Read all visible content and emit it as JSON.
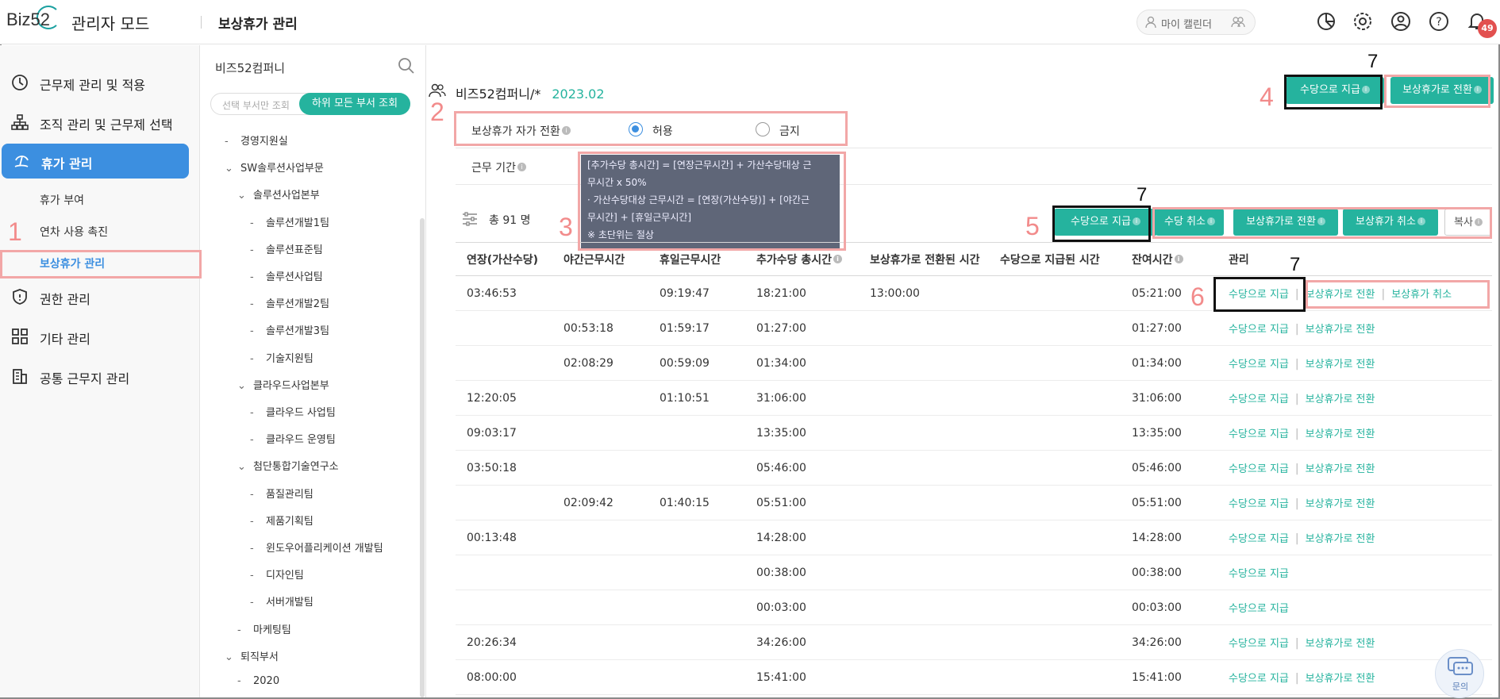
{
  "app": {
    "logo": "Biz52",
    "mode": "관리자 모드",
    "page": "보상휴가 관리"
  },
  "header": {
    "my_calendar": "마이 캘린더",
    "notif_count": "49"
  },
  "nav": {
    "items": [
      {
        "label": "근무제 관리 및 적용",
        "icon": "clock-icon"
      },
      {
        "label": "조직 관리 및 근무제 선택",
        "icon": "org-chart-icon"
      },
      {
        "label": "휴가 관리",
        "icon": "vacation-icon",
        "active": true
      },
      {
        "label": "권한 관리",
        "icon": "shield-icon"
      },
      {
        "label": "기타 관리",
        "icon": "grid-icon"
      },
      {
        "label": "공통 근무지 관리",
        "icon": "building-icon"
      }
    ],
    "sub": [
      "휴가 부여",
      "연차 사용 촉진",
      "보상휴가 관리"
    ]
  },
  "tree": {
    "company": "비즈52컴퍼니",
    "toggle_off": "선택 부서만 조회",
    "toggle_on": "하위 모든 부서 조회",
    "nodes": [
      {
        "label": "경영지원실",
        "mark": "-"
      },
      {
        "label": "SW솔루션사업부문",
        "mark": "v"
      },
      {
        "label": "솔루션사업본부",
        "mark": "v"
      },
      {
        "label": "솔루션개발1팀",
        "mark": "-"
      },
      {
        "label": "솔루션표준팀",
        "mark": "-"
      },
      {
        "label": "솔루션사업팀",
        "mark": "-"
      },
      {
        "label": "솔루션개발2팀",
        "mark": "-"
      },
      {
        "label": "솔루션개발3팀",
        "mark": "-"
      },
      {
        "label": "기술지원팀",
        "mark": "-"
      },
      {
        "label": "클라우드사업본부",
        "mark": "v"
      },
      {
        "label": "클라우드 사업팀",
        "mark": "-"
      },
      {
        "label": "클라우드 운영팀",
        "mark": "-"
      },
      {
        "label": "첨단통합기술연구소",
        "mark": "v"
      },
      {
        "label": "품질관리팀",
        "mark": "-"
      },
      {
        "label": "제품기획팀",
        "mark": "-"
      },
      {
        "label": "윈도우어플리케이션 개발팀",
        "mark": "-"
      },
      {
        "label": "디자인팀",
        "mark": "-"
      },
      {
        "label": "서버개발팀",
        "mark": "-"
      },
      {
        "label": "마케팅팀",
        "mark": "-"
      },
      {
        "label": "퇴직부서",
        "mark": "v"
      },
      {
        "label": "2020",
        "mark": "-"
      }
    ]
  },
  "main": {
    "org_path": "비즈52컴퍼니/*",
    "period": "2023.02",
    "top_buttons": [
      "수당으로 지급",
      "보상휴가로 전환"
    ],
    "auto_convert_label": "보상휴가 자가 전환",
    "radio_allow": "허용",
    "radio_deny": "금지",
    "work_period_label": "근무 기간",
    "tooltip": [
      "[추가수당 총시간] = [연장근무시간] + 가산수당대상 근",
      "무시간 x 50%",
      "· 가산수당대상 근무시간 = [연장(가산수당)] + [야간근",
      "무시간] + [휴일근무시간]",
      "※ 초단위는 절상"
    ],
    "count_text": "총 91 명",
    "action_buttons": [
      "수당으로 지급",
      "수당 취소",
      "보상휴가로 전환",
      "보상휴가 취소",
      "복사"
    ],
    "columns": [
      "연장(가산수당)",
      "야간근무시간",
      "휴일근무시간",
      "추가수당 총시간",
      "보상휴가로 전환된 시간",
      "수당으로 지급된 시간",
      "잔여시간",
      "관리"
    ],
    "rows": [
      {
        "c": [
          "03:46:53",
          "",
          "09:19:47",
          "18:21:00",
          "13:00:00",
          "",
          "05:21:00"
        ],
        "acts": [
          "수당으로 지급",
          "보상휴가로 전환",
          "보상휴가 취소"
        ]
      },
      {
        "c": [
          "",
          "00:53:18",
          "01:59:17",
          "01:27:00",
          "",
          "",
          "01:27:00"
        ],
        "acts": [
          "수당으로 지급",
          "보상휴가로 전환"
        ]
      },
      {
        "c": [
          "",
          "02:08:29",
          "00:59:09",
          "01:34:00",
          "",
          "",
          "01:34:00"
        ],
        "acts": [
          "수당으로 지급",
          "보상휴가로 전환"
        ]
      },
      {
        "c": [
          "12:20:05",
          "",
          "01:10:51",
          "31:06:00",
          "",
          "",
          "31:06:00"
        ],
        "acts": [
          "수당으로 지급",
          "보상휴가로 전환"
        ]
      },
      {
        "c": [
          "09:03:17",
          "",
          "",
          "13:35:00",
          "",
          "",
          "13:35:00"
        ],
        "acts": [
          "수당으로 지급",
          "보상휴가로 전환"
        ]
      },
      {
        "c": [
          "03:50:18",
          "",
          "",
          "05:46:00",
          "",
          "",
          "05:46:00"
        ],
        "acts": [
          "수당으로 지급",
          "보상휴가로 전환"
        ]
      },
      {
        "c": [
          "",
          "02:09:42",
          "01:40:15",
          "05:51:00",
          "",
          "",
          "05:51:00"
        ],
        "acts": [
          "수당으로 지급",
          "보상휴가로 전환"
        ]
      },
      {
        "c": [
          "00:13:48",
          "",
          "",
          "14:28:00",
          "",
          "",
          "14:28:00"
        ],
        "acts": [
          "수당으로 지급",
          "보상휴가로 전환"
        ]
      },
      {
        "c": [
          "",
          "",
          "",
          "00:38:00",
          "",
          "",
          "00:38:00"
        ],
        "acts": [
          "수당으로 지급"
        ]
      },
      {
        "c": [
          "",
          "",
          "",
          "00:03:00",
          "",
          "",
          "00:03:00"
        ],
        "acts": [
          "수당으로 지급"
        ]
      },
      {
        "c": [
          "20:26:34",
          "",
          "",
          "34:26:00",
          "",
          "",
          "34:26:00"
        ],
        "acts": [
          "수당으로 지급",
          "보상휴가로 전환"
        ]
      },
      {
        "c": [
          "08:00:00",
          "",
          "",
          "15:41:00",
          "",
          "",
          "15:41:00"
        ],
        "acts": [
          "수당으로 지급",
          "보상휴가로 전환"
        ]
      }
    ]
  },
  "annotations": {
    "n1": "1",
    "n2": "2",
    "n3": "3",
    "n4": "4",
    "n5": "5",
    "n6": "6",
    "n7": "7"
  },
  "chat": {
    "label": "문의"
  },
  "colors": {
    "accent": "#25b39e",
    "nav_active": "#3c8fe0",
    "annotation_red": "#f2a7a7",
    "badge": "#e2504f"
  }
}
